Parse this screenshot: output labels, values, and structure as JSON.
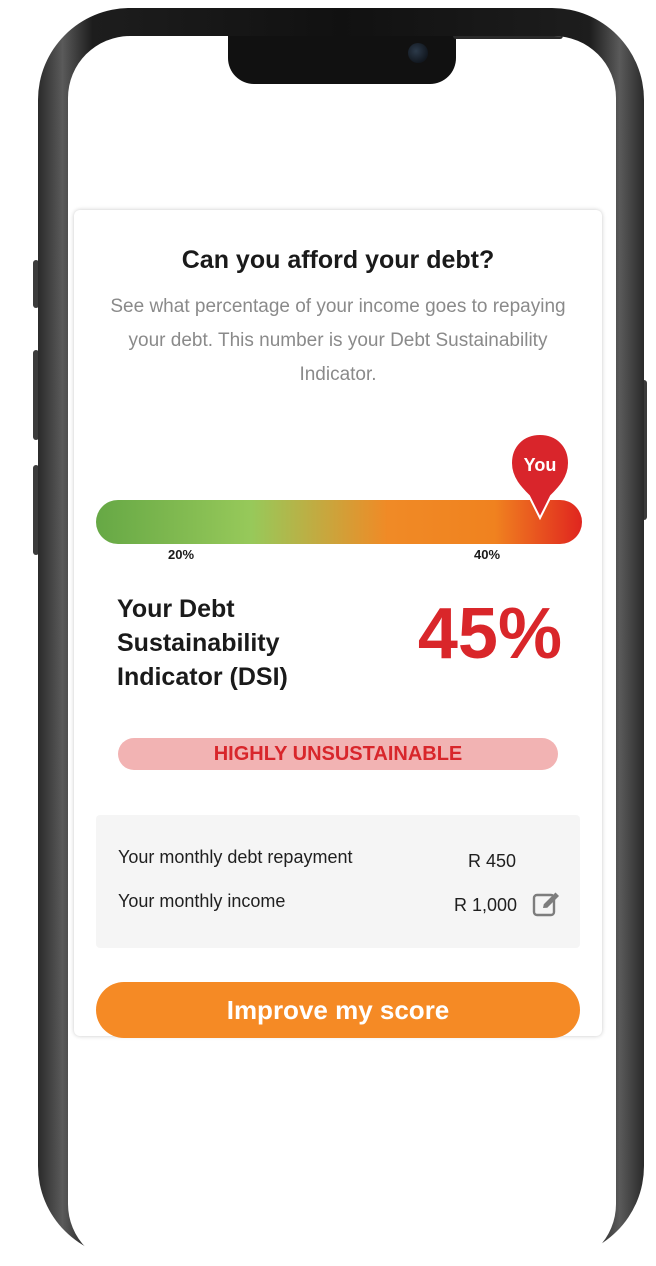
{
  "card": {
    "title": "Can you afford your debt?",
    "subtitle": "See what percentage of your income goes to repaying your debt. This number is your Debt Sustainability Indicator."
  },
  "gauge": {
    "marker_label": "You",
    "marker_value_percent": 45,
    "ticks": [
      "20%",
      "40%"
    ],
    "colors": [
      "#66a845",
      "#97c95a",
      "#f08a26",
      "#e0251f"
    ]
  },
  "dsi": {
    "label": "Your Debt Sustainability Indicator (DSI)",
    "value": "45%",
    "status": "HIGHLY UNSUSTAINABLE",
    "status_color": "#d8262b"
  },
  "details": {
    "rows": [
      {
        "label": "Your monthly debt repayment",
        "value": "R 450"
      },
      {
        "label": "Your monthly income",
        "value": "R 1,000",
        "icon": "edit-icon"
      }
    ]
  },
  "cta": {
    "label": "Improve my score",
    "color": "#f58a25"
  }
}
